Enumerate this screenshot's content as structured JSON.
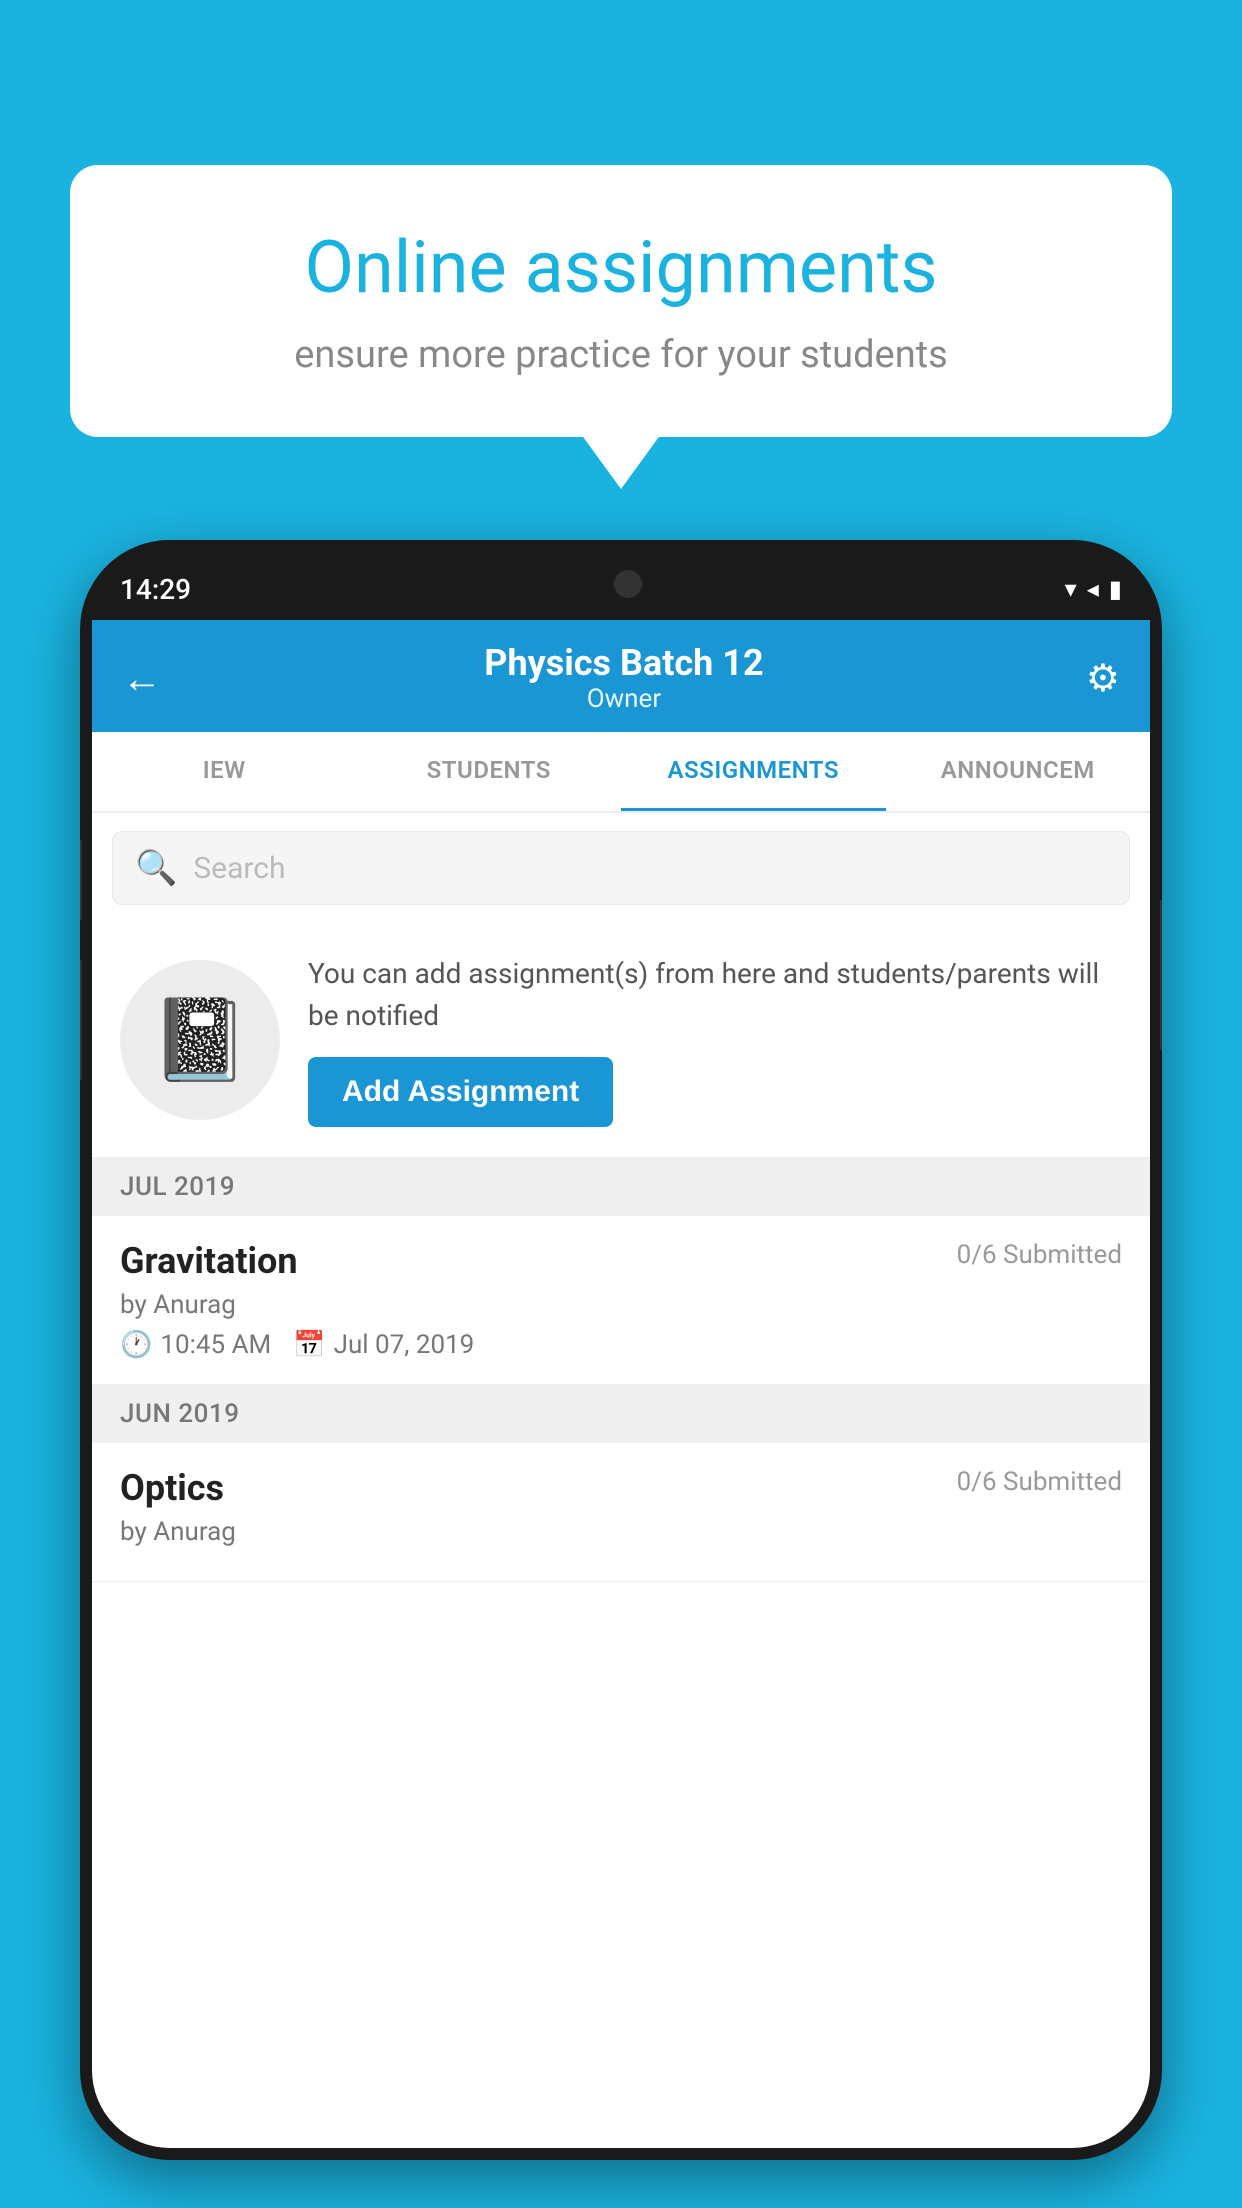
{
  "background": {
    "color": "#1ab3e0"
  },
  "speech_bubble": {
    "title": "Online assignments",
    "subtitle": "ensure more practice for your students"
  },
  "phone": {
    "status_bar": {
      "time": "14:29",
      "wifi_icon": "▼",
      "signal_icon": "◀",
      "battery_icon": "▮"
    },
    "header": {
      "back_label": "←",
      "title": "Physics Batch 12",
      "subtitle": "Owner",
      "settings_label": "⚙"
    },
    "tabs": [
      {
        "label": "IEW",
        "active": false
      },
      {
        "label": "STUDENTS",
        "active": false
      },
      {
        "label": "ASSIGNMENTS",
        "active": true
      },
      {
        "label": "ANNOUNCEM",
        "active": false
      }
    ],
    "search": {
      "placeholder": "Search"
    },
    "add_assignment": {
      "info_text": "You can add assignment(s) from here and students/parents will be notified",
      "button_label": "Add Assignment"
    },
    "assignment_groups": [
      {
        "month": "JUL 2019",
        "assignments": [
          {
            "title": "Gravitation",
            "submitted": "0/6 Submitted",
            "author": "by Anurag",
            "time": "10:45 AM",
            "date": "Jul 07, 2019"
          }
        ]
      },
      {
        "month": "JUN 2019",
        "assignments": [
          {
            "title": "Optics",
            "submitted": "0/6 Submitted",
            "author": "by Anurag",
            "time": "",
            "date": ""
          }
        ]
      }
    ]
  }
}
